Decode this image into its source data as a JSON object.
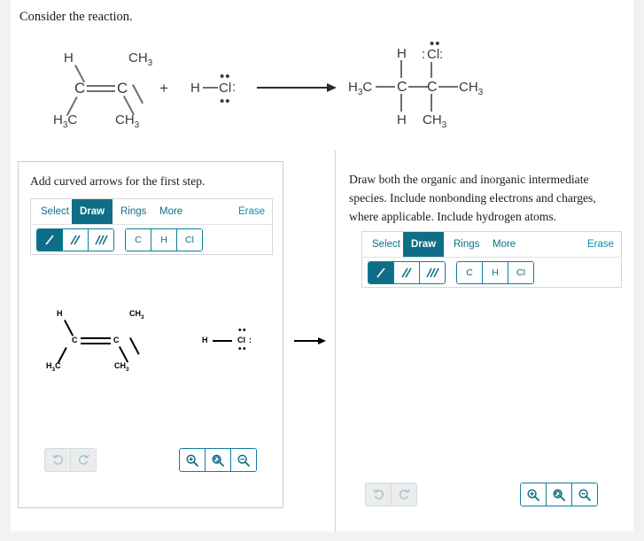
{
  "prompt": "Consider the reaction.",
  "reaction": {
    "reactant_alkene": {
      "top_left": "H",
      "top_right": "CH3",
      "left_carbon": "C",
      "right_carbon": "C",
      "bottom_left": "H3C",
      "bottom_right": "CH3",
      "bond_type": "double"
    },
    "plus_sign": "+",
    "reactant_hcl": {
      "h": "H",
      "cl": "Cl",
      "lone_pair_top": "••",
      "lone_pair_bottom": "••",
      "lone_pair_right": ":"
    },
    "arrow": "→",
    "product": {
      "left_methyl": "H3C",
      "c2_top": "H",
      "c2_bottom": "H",
      "c2": "C",
      "c3": "C",
      "c3_top_cl": "Cl",
      "c3_cl_lone_top": "••",
      "c3_cl_lone_left": ":",
      "c3_cl_lone_right": ":",
      "c3_bottom": "CH3",
      "right_methyl": "CH3"
    }
  },
  "left_panel": {
    "instruction": "Add curved arrows for the first step.",
    "toolbar": {
      "tabs": [
        {
          "label": "Select",
          "active": false
        },
        {
          "label": "Draw",
          "active": true
        },
        {
          "label": "Rings",
          "active": false
        },
        {
          "label": "More",
          "active": false
        }
      ],
      "erase_label": "Erase",
      "bond_buttons": [
        {
          "name": "single-bond",
          "active": true
        },
        {
          "name": "double-bond",
          "active": false
        },
        {
          "name": "triple-bond",
          "active": false
        }
      ],
      "element_buttons": [
        "C",
        "H",
        "Cl"
      ]
    },
    "canvas": {
      "alkene": {
        "top_left": "H",
        "top_right": "CH3",
        "left_carbon": "C",
        "right_carbon": "C",
        "bottom_left": "H3C",
        "bottom_right": "CH3"
      },
      "hcl": {
        "h": "H",
        "cl": "Cl",
        "lone_pair_top": "••",
        "lone_pair_bottom": "••",
        "lone_pair_right": ":"
      },
      "arrow": "→"
    },
    "controls": {
      "undo": "undo-icon",
      "redo": "redo-icon",
      "zoom_in": "zoom-in-icon",
      "zoom_reset": "zoom-reset-icon",
      "zoom_out": "zoom-out-icon"
    }
  },
  "right_panel": {
    "instruction": "Draw both the organic and inorganic intermediate species. Include nonbonding electrons and charges, where applicable. Include hydrogen atoms.",
    "toolbar": {
      "tabs": [
        {
          "label": "Select",
          "active": false
        },
        {
          "label": "Draw",
          "active": true
        },
        {
          "label": "Rings",
          "active": false
        },
        {
          "label": "More",
          "active": false
        }
      ],
      "erase_label": "Erase",
      "bond_buttons": [
        {
          "name": "single-bond",
          "active": true
        },
        {
          "name": "double-bond",
          "active": false
        },
        {
          "name": "triple-bond",
          "active": false
        }
      ],
      "element_buttons": [
        "C",
        "H",
        "Cl"
      ]
    },
    "canvas": {
      "content": ""
    },
    "controls": {
      "undo": "undo-icon",
      "redo": "redo-icon",
      "zoom_in": "zoom-in-icon",
      "zoom_reset": "zoom-reset-icon",
      "zoom_out": "zoom-out-icon"
    }
  },
  "colors": {
    "accent_teal": "#0f6e87",
    "accent_link": "#0f8aa8",
    "panel_border": "#cccccc",
    "page_bg": "#f2f2f2"
  }
}
